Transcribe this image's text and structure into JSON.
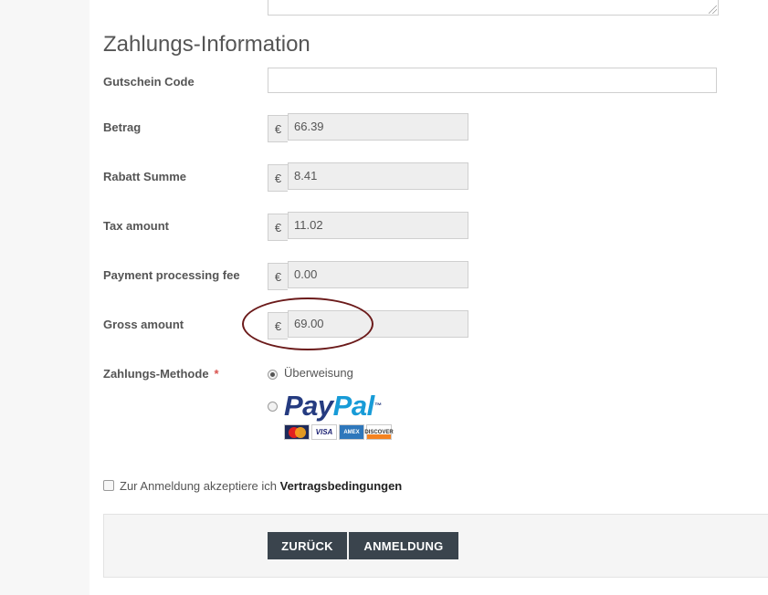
{
  "section_title": "Zahlungs-Information",
  "coupon": {
    "label": "Gutschein Code",
    "value": "",
    "placeholder": ""
  },
  "currency_symbol": "€",
  "amounts": [
    {
      "label": "Betrag",
      "value": "66.39"
    },
    {
      "label": "Rabatt Summe",
      "value": "8.41"
    },
    {
      "label": "Tax amount",
      "value": "11.02"
    },
    {
      "label": "Payment processing fee",
      "value": "0.00"
    },
    {
      "label": "Gross amount",
      "value": "69.00"
    }
  ],
  "payment_method": {
    "label": "Zahlungs-Methode",
    "required_mark": "*",
    "options": [
      {
        "label": "Überweisung",
        "selected": true
      },
      {
        "label": "PayPal",
        "selected": false,
        "logo_pay": "Pay",
        "logo_pal": "Pal",
        "logo_tm": "™"
      }
    ],
    "cards": [
      {
        "name": "MasterCard",
        "icon": "mastercard-icon"
      },
      {
        "name": "VISA",
        "icon": "visa-icon"
      },
      {
        "name": "AMERICAN EXPRESS",
        "icon": "amex-icon"
      },
      {
        "name": "DISCOVER",
        "icon": "discover-icon"
      }
    ]
  },
  "terms": {
    "text": "Zur Anmeldung akzeptiere ich",
    "link": "Vertragsbedingungen",
    "checked": false
  },
  "buttons": {
    "back": "ZURÜCK",
    "submit": "ANMELDUNG"
  },
  "colors": {
    "button_bg": "#3a444d",
    "highlight_ellipse": "#6b1a1a",
    "required_star": "#d9534f",
    "paypal_dark": "#253b80",
    "paypal_light": "#179bd7"
  }
}
